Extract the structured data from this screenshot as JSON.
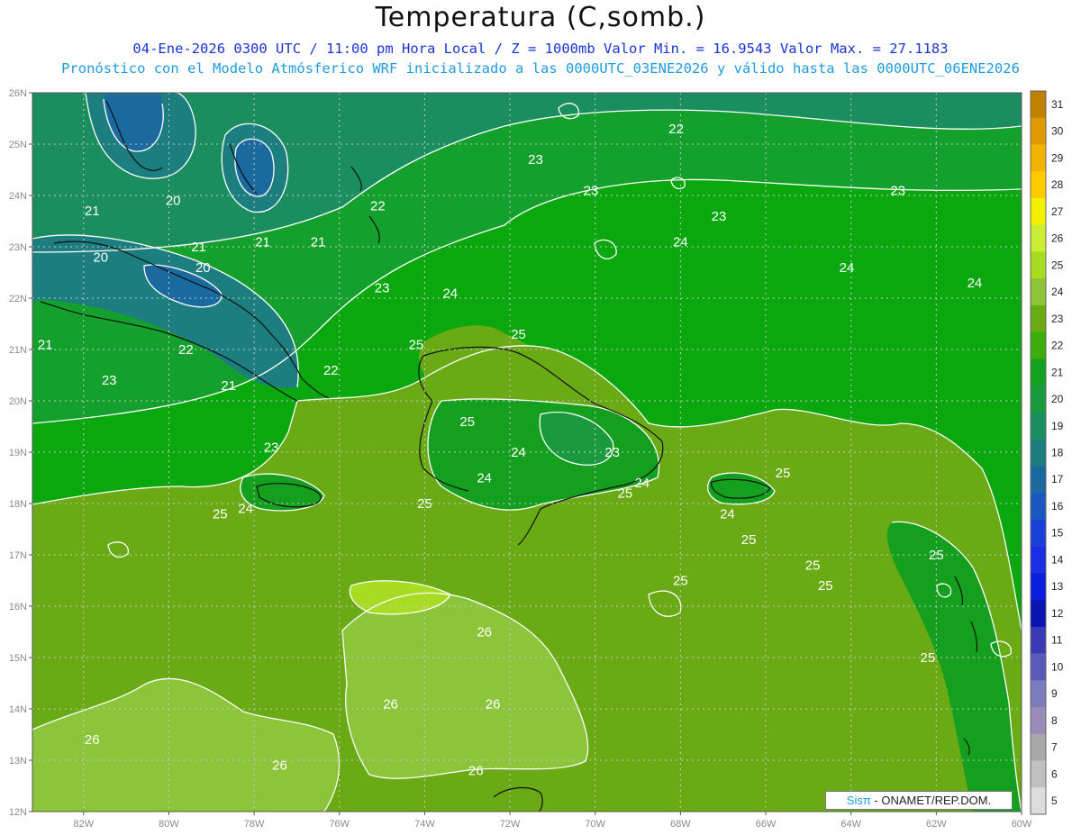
{
  "title": "Temperatura (C,somb.)",
  "subtitle_line1": "04-Ene-2026 0300 UTC / 11:00 pm Hora Local / Z = 1000mb  Valor Min. = 16.9543  Valor Max. = 27.1183",
  "subtitle_line2": "Pronóstico con el Modelo Atmósferico WRF inicializado a las 0000UTC_03ENE2026 y válido hasta las  0000UTC_06ENE2026",
  "credit": {
    "brand": "Sisπ",
    "text": " - ONAMET/REP.DOM."
  },
  "map": {
    "lat_ticks": [
      "26N",
      "25N",
      "24N",
      "23N",
      "22N",
      "21N",
      "20N",
      "19N",
      "18N",
      "17N",
      "16N",
      "15N",
      "14N",
      "13N",
      "12N"
    ],
    "lon_ticks": [
      "82W",
      "80W",
      "78W",
      "76W",
      "74W",
      "72W",
      "70W",
      "68W",
      "66W",
      "64W",
      "62W",
      "60W"
    ],
    "lat_range": [
      12,
      26
    ],
    "lon_range": [
      -83.2,
      -60
    ],
    "contour_labels": [
      {
        "text": "22",
        "lon": -68.1,
        "lat": 25.3
      },
      {
        "text": "23",
        "lon": -71.4,
        "lat": 24.7
      },
      {
        "text": "23",
        "lon": -70.1,
        "lat": 24.1
      },
      {
        "text": "23",
        "lon": -62.9,
        "lat": 24.1
      },
      {
        "text": "23",
        "lon": -67.1,
        "lat": 23.6
      },
      {
        "text": "22",
        "lon": -75.1,
        "lat": 23.8
      },
      {
        "text": "21",
        "lon": -81.8,
        "lat": 23.7
      },
      {
        "text": "20",
        "lon": -79.9,
        "lat": 23.9
      },
      {
        "text": "21",
        "lon": -79.3,
        "lat": 23.0
      },
      {
        "text": "21",
        "lon": -77.8,
        "lat": 23.1
      },
      {
        "text": "21",
        "lon": -76.5,
        "lat": 23.1
      },
      {
        "text": "20",
        "lon": -81.6,
        "lat": 22.8
      },
      {
        "text": "20",
        "lon": -79.2,
        "lat": 22.6
      },
      {
        "text": "24",
        "lon": -68.0,
        "lat": 23.1
      },
      {
        "text": "24",
        "lon": -64.1,
        "lat": 22.6
      },
      {
        "text": "24",
        "lon": -61.1,
        "lat": 22.3
      },
      {
        "text": "23",
        "lon": -75.0,
        "lat": 22.2
      },
      {
        "text": "24",
        "lon": -73.4,
        "lat": 22.1
      },
      {
        "text": "25",
        "lon": -71.8,
        "lat": 21.3
      },
      {
        "text": "25",
        "lon": -74.2,
        "lat": 21.1
      },
      {
        "text": "21",
        "lon": -82.9,
        "lat": 21.1
      },
      {
        "text": "22",
        "lon": -79.6,
        "lat": 21.0
      },
      {
        "text": "22",
        "lon": -76.2,
        "lat": 20.6
      },
      {
        "text": "23",
        "lon": -81.4,
        "lat": 20.4
      },
      {
        "text": "21",
        "lon": -78.6,
        "lat": 20.3
      },
      {
        "text": "25",
        "lon": -73.0,
        "lat": 19.6
      },
      {
        "text": "23",
        "lon": -77.6,
        "lat": 19.1
      },
      {
        "text": "24",
        "lon": -71.8,
        "lat": 19.0
      },
      {
        "text": "23",
        "lon": -69.6,
        "lat": 19.0
      },
      {
        "text": "24",
        "lon": -72.6,
        "lat": 18.5
      },
      {
        "text": "24",
        "lon": -68.9,
        "lat": 18.4
      },
      {
        "text": "25",
        "lon": -69.3,
        "lat": 18.2
      },
      {
        "text": "25",
        "lon": -74.0,
        "lat": 18.0
      },
      {
        "text": "25",
        "lon": -65.6,
        "lat": 18.6
      },
      {
        "text": "24",
        "lon": -78.2,
        "lat": 17.9
      },
      {
        "text": "25",
        "lon": -78.8,
        "lat": 17.8
      },
      {
        "text": "24",
        "lon": -66.9,
        "lat": 17.8
      },
      {
        "text": "25",
        "lon": -66.4,
        "lat": 17.3
      },
      {
        "text": "25",
        "lon": -62.0,
        "lat": 17.0
      },
      {
        "text": "25",
        "lon": -64.9,
        "lat": 16.8
      },
      {
        "text": "25",
        "lon": -68.0,
        "lat": 16.5
      },
      {
        "text": "25",
        "lon": -64.6,
        "lat": 16.4
      },
      {
        "text": "26",
        "lon": -72.6,
        "lat": 15.5
      },
      {
        "text": "25",
        "lon": -62.2,
        "lat": 15.0
      },
      {
        "text": "26",
        "lon": -74.8,
        "lat": 14.1
      },
      {
        "text": "26",
        "lon": -72.4,
        "lat": 14.1
      },
      {
        "text": "26",
        "lon": -81.8,
        "lat": 13.4
      },
      {
        "text": "26",
        "lon": -77.4,
        "lat": 12.9
      },
      {
        "text": "26",
        "lon": -72.8,
        "lat": 12.8
      }
    ]
  },
  "colorbar": {
    "labels": [
      "31",
      "30",
      "29",
      "28",
      "27",
      "26",
      "25",
      "24",
      "23",
      "22",
      "21",
      "20",
      "19",
      "18",
      "17",
      "16",
      "15",
      "14",
      "13",
      "12",
      "11",
      "10",
      "9",
      "8",
      "7",
      "6",
      "5"
    ],
    "colors": [
      "#c08000",
      "#e09a00",
      "#f0b400",
      "#ffcc00",
      "#f2f200",
      "#caee33",
      "#a8dc22",
      "#8cc43a",
      "#6aaa14",
      "#3cae0c",
      "#14a01e",
      "#1a9a3c",
      "#1a8e5e",
      "#1c7e7e",
      "#1a6aa0",
      "#1a58c0",
      "#1a40d8",
      "#1a2ee6",
      "#0a1ee0",
      "#0a14b0",
      "#3a3ab6",
      "#5a5aba",
      "#7c7cbc",
      "#9a8ab8",
      "#a8a8a8",
      "#c0c0c0",
      "#dcdcdc"
    ]
  }
}
